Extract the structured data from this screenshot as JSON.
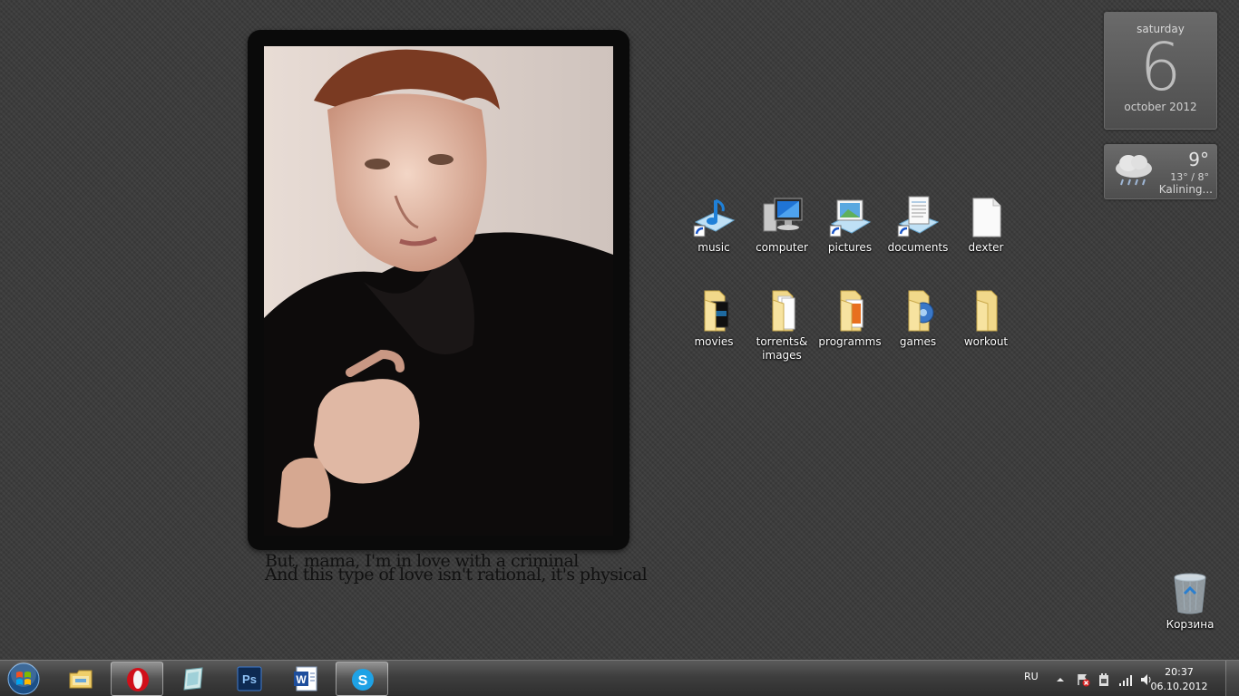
{
  "photo": {
    "lyrics_line1": "But, mama, I'm in love with a criminal",
    "lyrics_line2": "And this type of love isn't rational, it's physical"
  },
  "gadgets": {
    "calendar": {
      "day_name": "saturday",
      "day_number": "6",
      "month_year": "october 2012"
    },
    "weather": {
      "temperature": "9°",
      "range": "13° / 8°",
      "city": "Kalining..."
    }
  },
  "desktop_icons": [
    {
      "label": "music",
      "icon": "music-shortcut-icon"
    },
    {
      "label": "computer",
      "icon": "computer-icon"
    },
    {
      "label": "pictures",
      "icon": "pictures-shortcut-icon"
    },
    {
      "label": "documents",
      "icon": "documents-shortcut-icon"
    },
    {
      "label": "dexter",
      "icon": "file-icon"
    },
    {
      "label": "movies",
      "icon": "folder-icon"
    },
    {
      "label": "torrents&\nimages",
      "icon": "folder-icon"
    },
    {
      "label": "programms",
      "icon": "folder-icon"
    },
    {
      "label": "games",
      "icon": "folder-icon"
    },
    {
      "label": "workout",
      "icon": "folder-icon"
    },
    {
      "label": "Корзина",
      "icon": "recycle-bin-icon"
    }
  ],
  "taskbar": {
    "pinned": [
      {
        "name": "explorer",
        "icon": "explorer-icon",
        "active": false
      },
      {
        "name": "opera",
        "icon": "opera-icon",
        "active": true
      },
      {
        "name": "notes",
        "icon": "notes-icon",
        "active": false
      },
      {
        "name": "photoshop",
        "icon": "photoshop-icon",
        "active": false,
        "text": "Ps"
      },
      {
        "name": "word",
        "icon": "word-icon",
        "active": false,
        "text": "W"
      },
      {
        "name": "skype",
        "icon": "skype-icon",
        "active": true,
        "text": "S"
      }
    ],
    "tray": {
      "language": "RU",
      "time": "20:37",
      "date": "06.10.2012"
    }
  }
}
